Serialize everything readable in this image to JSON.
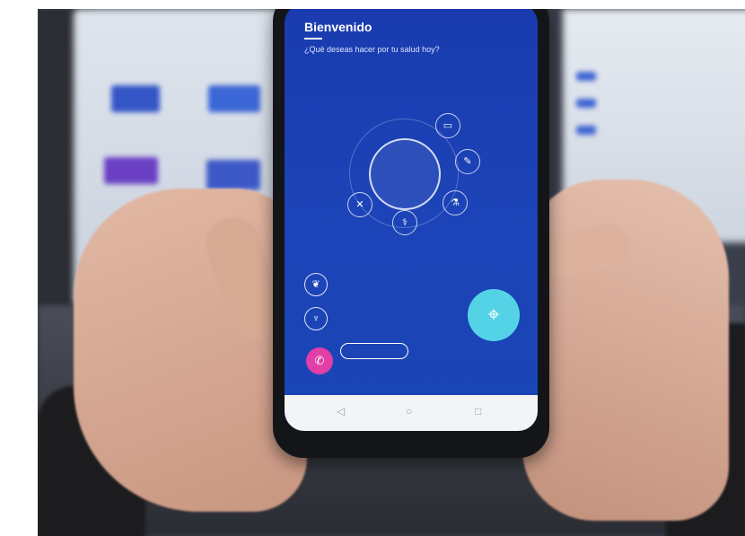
{
  "photo": {
    "description_colors": {
      "screen": "#1c44b8",
      "accent_cyan": "#55d3e6",
      "accent_magenta": "#e13ea6"
    }
  },
  "app": {
    "welcome_title": "Bienvenido",
    "question": "¿Qué deseas hacer por tu salud hoy?",
    "hub_label": "",
    "nodes": [
      {
        "icon": "calendar-icon",
        "glyph": "▭",
        "label": ""
      },
      {
        "icon": "pencil-icon",
        "glyph": "✎",
        "label": ""
      },
      {
        "icon": "flask-icon",
        "glyph": "⚗",
        "label": ""
      },
      {
        "icon": "doctor-icon",
        "glyph": "⚕",
        "label": ""
      },
      {
        "icon": "cross-icon",
        "glyph": "✕",
        "label": ""
      }
    ],
    "menu": [
      {
        "icon": "leaf-icon",
        "glyph": "❦",
        "label": ""
      },
      {
        "icon": "tooth-icon",
        "glyph": "♆",
        "label": ""
      }
    ],
    "phone_number": "",
    "call_icon": "video-call-icon",
    "location_icon": "map-pin-icon",
    "nav": [
      {
        "icon": "back-icon",
        "glyph": "◁"
      },
      {
        "icon": "home-icon",
        "glyph": "○"
      },
      {
        "icon": "recent-icon",
        "glyph": "□"
      }
    ]
  }
}
